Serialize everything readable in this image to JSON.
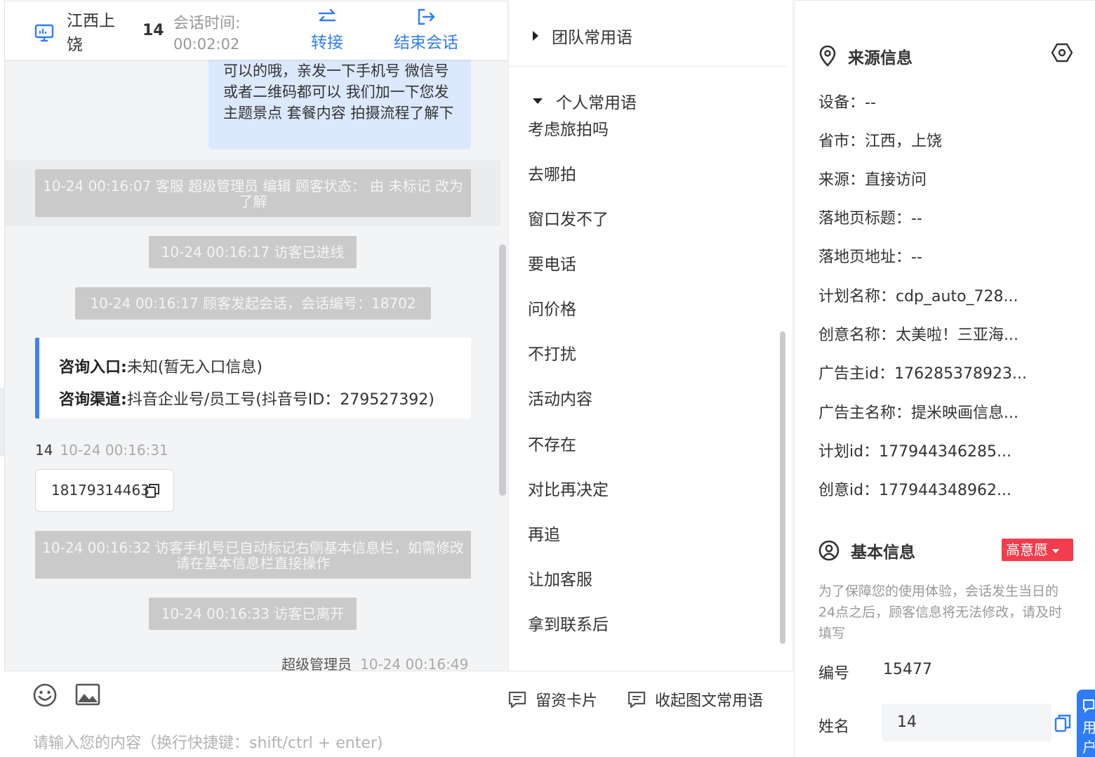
{
  "colors": {
    "accent": "#2f7cf6",
    "bubble": "#dbe8fd",
    "system": "#cacaca",
    "danger": "#f13d4d"
  },
  "header": {
    "region": "江西上饶",
    "visitor_id": "14",
    "time_label": "会话时间:",
    "time_value": "00:02:02",
    "transfer_label": "转接",
    "end_label": "结束会话"
  },
  "messages": {
    "agent_bubble": "可以的哦，亲发一下手机号 微信号或者二维码都可以 我们加一下您发主题景点 套餐内容 拍摄流程了解下",
    "system1": "10-24 00:16:07 客服 超级管理员 编辑 顾客状态： 由 未标记 改为 了解",
    "system2": "10-24 00:16:17 访客已进线",
    "system3": "10-24 00:16:17 顾客发起会话，会话编号：18702",
    "entry_label": "咨询入口:",
    "entry_value": "未知(暂无入口信息)",
    "channel_label": "咨询渠道:",
    "channel_value": "抖音企业号/员工号(抖音号ID：279527392)",
    "visitor_name": "14",
    "visitor_time": "10-24 00:16:31",
    "phone": "18179314463",
    "system4": "10-24 00:16:32 访客手机号已自动标记右侧基本信息栏，如需修改请在基本信息栏直接操作",
    "system5": "10-24 00:16:33 访客已离开",
    "admin_name": "超级管理员",
    "admin_time": "10-24 00:16:49"
  },
  "input": {
    "placeholder": "请输入您的内容（换行快捷键：shift/ctrl + enter)",
    "card_label": "留资卡片",
    "collapse_label": "收起图文常用语"
  },
  "phrases": {
    "team_group": "团队常用语",
    "personal_group": "个人常用语",
    "items": [
      "考虑旅拍吗",
      "去哪拍",
      "窗口发不了",
      "要电话",
      "问价格",
      "不打扰",
      "活动内容",
      "不存在",
      "对比再决定",
      "再追",
      "让加客服",
      "拿到联系后"
    ]
  },
  "source_info": {
    "title": "来源信息",
    "rows": [
      "设备：--",
      "省市：江西，上饶",
      "来源：直接访问",
      "落地页标题：--",
      "落地页地址：--",
      "计划名称：cdp_auto_728...",
      "创意名称：太美啦！三亚海...",
      "广告主id：176285378923...",
      "广告主名称：提米映画信息...",
      "计划id：177944346285...",
      "创意id：177944348962..."
    ]
  },
  "basic_info": {
    "title": "基本信息",
    "intent_tag": "高意愿",
    "notice": "为了保障您的使用体验，会话发生当日的24点之后，顾客信息将无法修改，请及时填写",
    "number_label": "编号",
    "number_value": "15477",
    "name_label": "姓名",
    "name_value": "14"
  },
  "float": {
    "text": "用户"
  }
}
